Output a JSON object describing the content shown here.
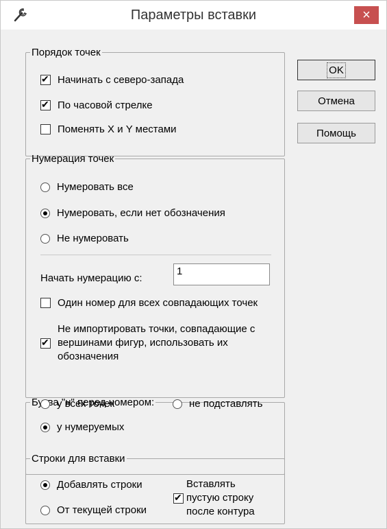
{
  "window": {
    "title": "Параметры вставки",
    "close_glyph": "×"
  },
  "buttons": {
    "ok": "OK",
    "cancel": "Отмена",
    "help": "Помощь"
  },
  "point_order": {
    "legend": "Порядок точек",
    "items": [
      {
        "label": "Начинать с северо-запада",
        "checked": true
      },
      {
        "label": "По часовой стрелке",
        "checked": true
      },
      {
        "label": "Поменять X и Y местами",
        "checked": false
      }
    ]
  },
  "numbering": {
    "legend": "Нумерация точек",
    "options": [
      {
        "label": "Нумеровать все",
        "selected": false
      },
      {
        "label": "Нумеровать, если нет обозначения",
        "selected": true
      },
      {
        "label": "Не нумеровать",
        "selected": false
      }
    ],
    "start_label": "Начать нумерацию с:",
    "start_value": "1",
    "same_number": {
      "label": "Один номер для всех совпадающих точек",
      "checked": false
    },
    "no_import": {
      "lines": [
        "Не импортировать точки, совпадающие с",
        "вершинами фигур, использовать их",
        "обозначения"
      ],
      "checked": true
    }
  },
  "letter_n": {
    "legend": "Буква \"н\" перед номером:",
    "options": [
      {
        "label": "у всех точек",
        "selected": false
      },
      {
        "label": "не подставлять",
        "selected": false
      },
      {
        "label": "у нумеруемых",
        "selected": true
      }
    ]
  },
  "rows": {
    "legend": "Строки для вставки",
    "options": [
      {
        "label": "Добавлять строки",
        "selected": true
      },
      {
        "label": "От текущей строки",
        "selected": false
      }
    ],
    "empty_line": {
      "lines": [
        "Вставлять",
        "пустую строку",
        "после контура"
      ],
      "checked": true
    }
  },
  "icons": {
    "app": "wrench-icon",
    "close": "close-icon"
  }
}
